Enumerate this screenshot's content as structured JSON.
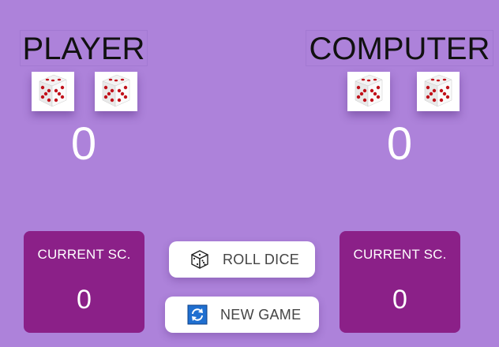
{
  "players": [
    {
      "name": "PLAYER",
      "dice": [
        5,
        5
      ],
      "total": "0",
      "current_label": "CURRENT SC.",
      "current_value": "0"
    },
    {
      "name": "COMPUTER",
      "dice": [
        5,
        5
      ],
      "total": "0",
      "current_label": "CURRENT SC.",
      "current_value": "0"
    }
  ],
  "buttons": {
    "roll_label": "ROLL DICE",
    "roll_icon": "dice-icon",
    "new_label": "NEW GAME",
    "new_icon": "refresh-icon"
  },
  "colors": {
    "background": "#ad82da",
    "current_box": "#8b2088",
    "pip": "#c1121b",
    "new_game_icon": "#1f6fd0"
  }
}
